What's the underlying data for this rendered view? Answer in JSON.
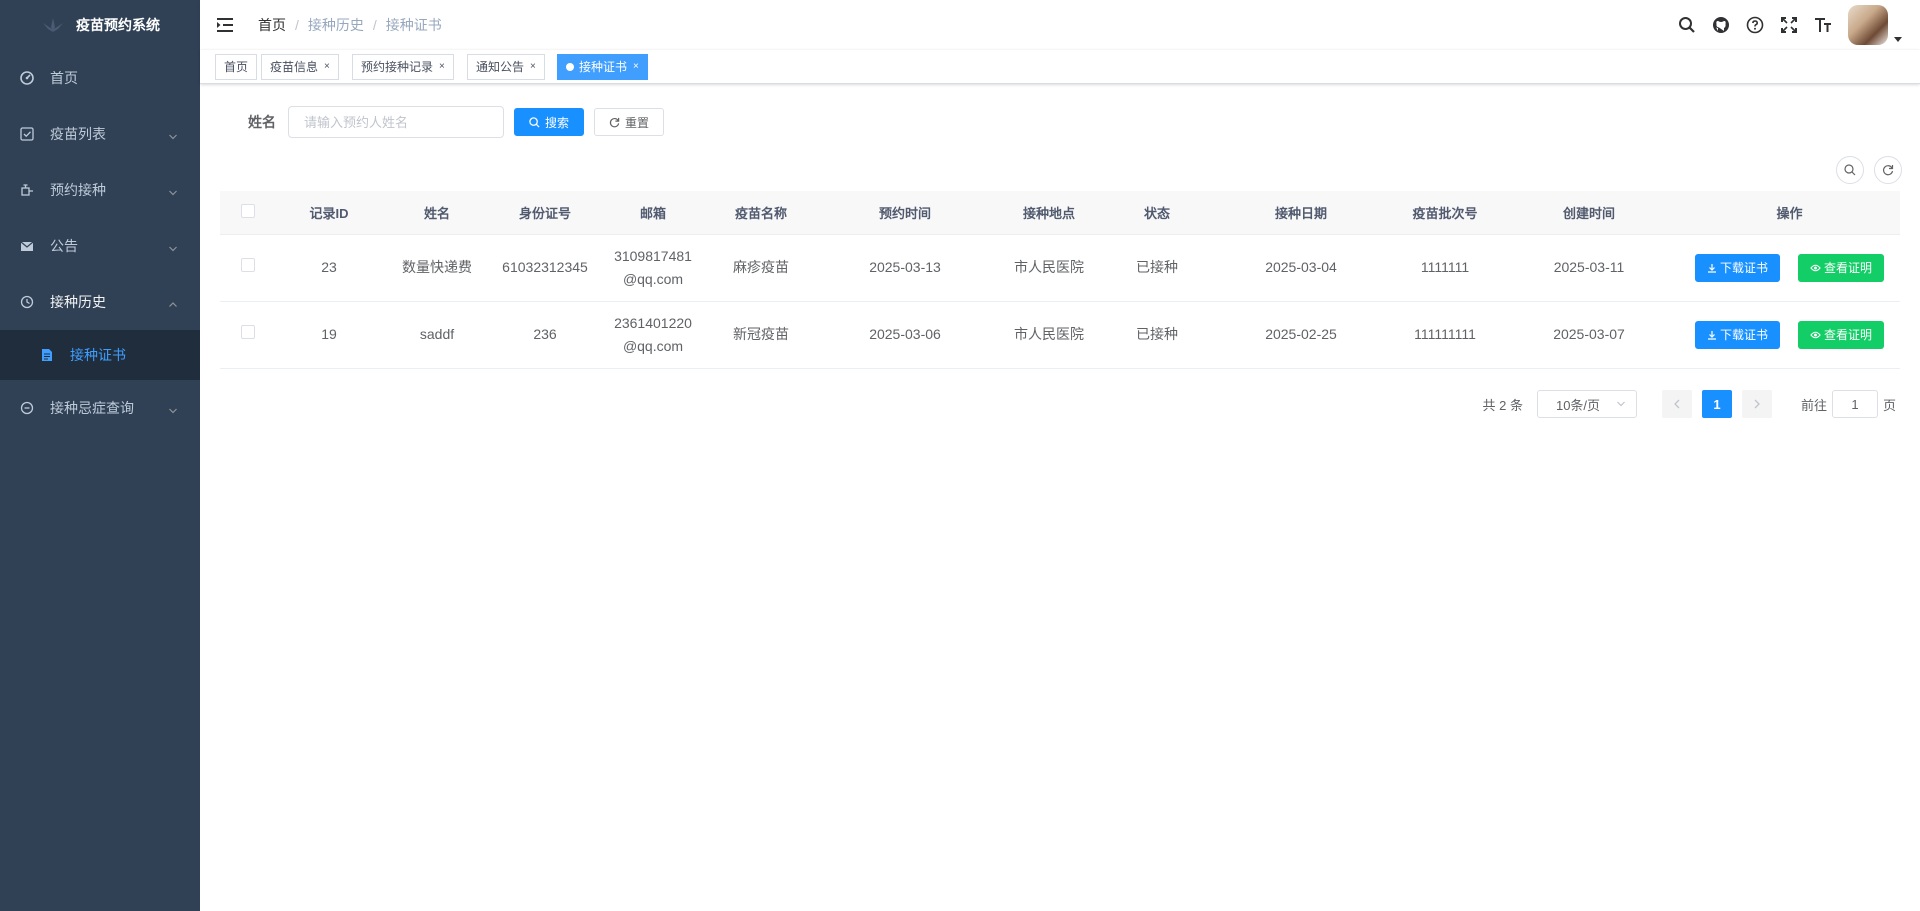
{
  "app": {
    "title": "疫苗预约系统"
  },
  "sidebar": {
    "items": [
      {
        "label": "首页",
        "icon": "dashboard-icon"
      },
      {
        "label": "疫苗列表",
        "icon": "checkbox-icon"
      },
      {
        "label": "预约接种",
        "icon": "syringe-icon"
      },
      {
        "label": "公告",
        "icon": "mail-icon"
      },
      {
        "label": "接种历史",
        "icon": "history-icon"
      },
      {
        "label": "接种证书",
        "icon": "document-icon"
      },
      {
        "label": "接种忌症查询",
        "icon": "query-icon"
      }
    ],
    "active_color": "#409eff"
  },
  "breadcrumb": [
    "首页",
    "接种历史",
    "接种证书"
  ],
  "tags": [
    {
      "label": "首页"
    },
    {
      "label": "疫苗信息"
    },
    {
      "label": "预约接种记录"
    },
    {
      "label": "通知公告"
    },
    {
      "label": "接种证书"
    }
  ],
  "search": {
    "label": "姓名",
    "placeholder": "请输入预约人姓名",
    "value": "",
    "search_button": "搜索",
    "reset_button": "重置"
  },
  "table": {
    "headers": [
      "记录ID",
      "姓名",
      "身份证号",
      "邮箱",
      "疫苗名称",
      "预约时间",
      "接种地点",
      "状态",
      "接种日期",
      "疫苗批次号",
      "创建时间",
      "操作"
    ],
    "rows": [
      {
        "id": "23",
        "name": "数量快递费",
        "idcard": "61032312345",
        "email_1": "3109817481",
        "email_2": "@qq.com",
        "vaccine": "麻疹疫苗",
        "appoint_time": "2025-03-13",
        "location": "市人民医院",
        "status": "已接种",
        "vacc_date": "2025-03-04",
        "batch": "1111111",
        "created": "2025-03-11"
      },
      {
        "id": "19",
        "name": "saddf",
        "idcard": "236",
        "email_1": "2361401220",
        "email_2": "@qq.com",
        "vaccine": "新冠疫苗",
        "appoint_time": "2025-03-06",
        "location": "市人民医院",
        "status": "已接种",
        "vacc_date": "2025-02-25",
        "batch": "111111111",
        "created": "2025-03-07"
      }
    ],
    "download_label": "下载证书",
    "view_label": "查看证明"
  },
  "pagination": {
    "total_text": "共 2 条",
    "page_size": "10条/页",
    "current_page": "1",
    "goto_prefix": "前往",
    "goto_value": "1",
    "goto_suffix": "页"
  },
  "colors": {
    "primary": "#1890ff",
    "success": "#13ce66",
    "sidebar_bg": "#304156",
    "submenu_bg": "#1f2d3d"
  }
}
